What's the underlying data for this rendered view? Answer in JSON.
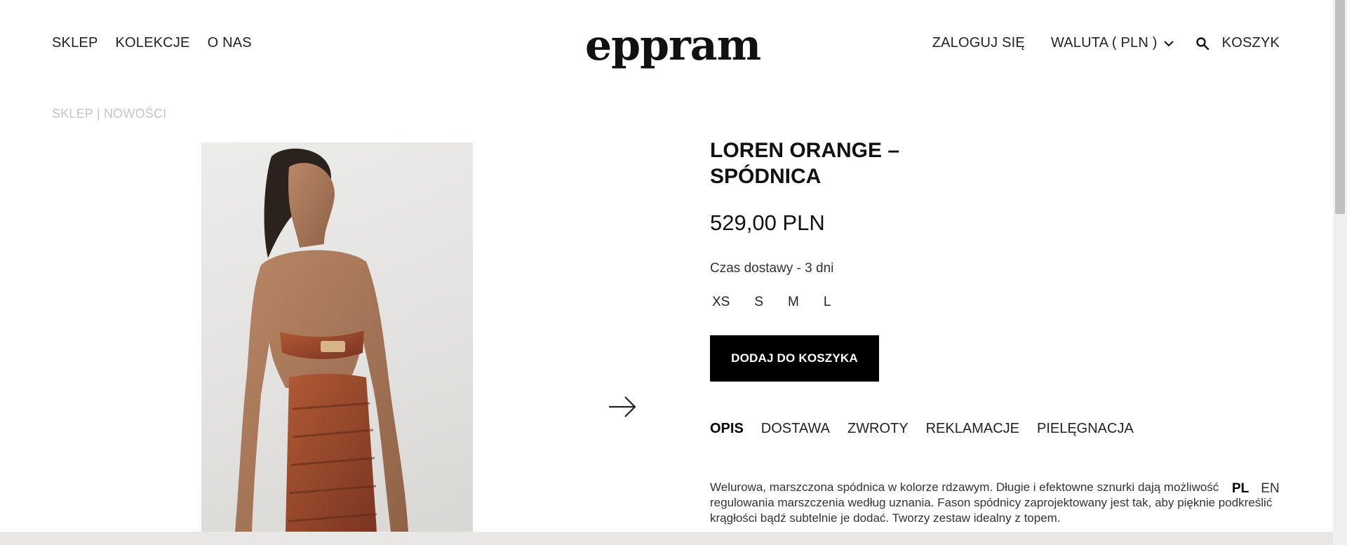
{
  "nav": {
    "left": [
      "SKLEP",
      "KOLEKCJE",
      "O NAS"
    ],
    "logo": "eppram",
    "login": "ZALOGUJ SIĘ",
    "currency": "WALUTA ( PLN )",
    "cart": "KOSZYK"
  },
  "breadcrumb": "SKLEP | NOWOŚCI",
  "product": {
    "title_line1": "LOREN ORANGE –",
    "title_line2": "SPÓDNICA",
    "price": "529,00 PLN",
    "delivery": "Czas dostawy - 3 dni",
    "sizes": [
      "XS",
      "S",
      "M",
      "L"
    ],
    "add_to_cart": "DODAJ DO KOSZYKA",
    "tabs": [
      "OPIS",
      "DOSTAWA",
      "ZWROTY",
      "REKLAMACJE",
      "PIELĘGNACJA"
    ],
    "active_tab": "OPIS",
    "description": "Welurowa, marszczona spódnica w kolorze rdzawym. Długie i efektowne sznurki dają możliwość regulowania marszczenia według uznania. Fason spódnicy zaprojektowany jest tak, aby pięknie podkreślić krągłości bądź subtelnie je dodać. Tworzy zestaw idealny z topem."
  },
  "languages": [
    "PL",
    "EN"
  ],
  "active_language": "PL",
  "colors": {
    "accent": "#000000",
    "breadcrumb": "#c4c4c4",
    "garment": "#9a4a2c"
  },
  "icons": {
    "chevron": "chevron-down-icon",
    "search": "search-icon",
    "next": "arrow-right-icon"
  }
}
